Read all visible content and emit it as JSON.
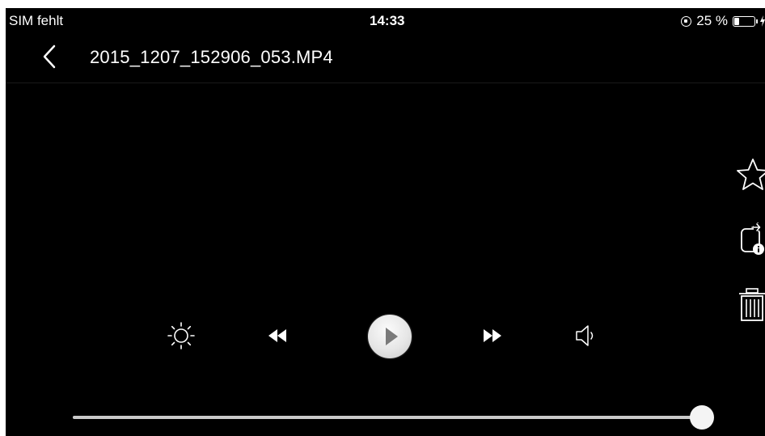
{
  "status_bar": {
    "carrier": "SIM fehlt",
    "time": "14:33",
    "battery_text": "25 %",
    "battery_level": 0.25
  },
  "header": {
    "back_icon": "chevron-left-icon",
    "file_name": "2015_1207_152906_053.MP4"
  },
  "side_actions": [
    {
      "name": "favorite",
      "icon": "star-outline-icon"
    },
    {
      "name": "rotate",
      "icon": "rotate-info-icon"
    },
    {
      "name": "delete",
      "icon": "trash-icon"
    }
  ],
  "controls": [
    {
      "name": "brightness",
      "icon": "brightness-icon"
    },
    {
      "name": "rewind",
      "icon": "rewind-icon"
    },
    {
      "name": "play",
      "icon": "play-icon"
    },
    {
      "name": "fast-forward",
      "icon": "fast-forward-icon"
    },
    {
      "name": "volume",
      "icon": "speaker-icon"
    }
  ],
  "progress": {
    "position": 0.985
  },
  "colors": {
    "background": "#000000",
    "foreground": "#ffffff",
    "play_button": "#e6e6e6",
    "track": "#c9c9c9"
  }
}
